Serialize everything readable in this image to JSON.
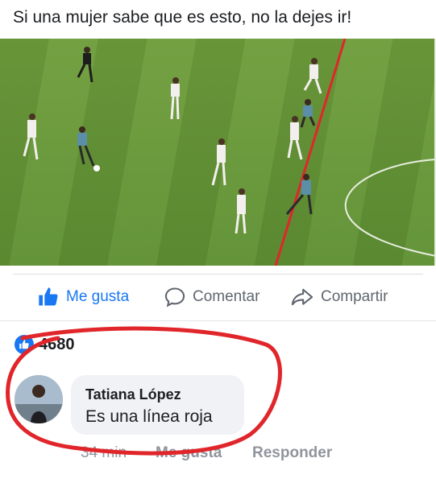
{
  "post": {
    "caption": "Si una mujer sabe que es esto, no la dejes ir!"
  },
  "actions": {
    "like_label": "Me gusta",
    "comment_label": "Comentar",
    "share_label": "Compartir"
  },
  "reactions": {
    "count": "4680"
  },
  "comment": {
    "author": "Tatiana López",
    "text": "Es una línea roja",
    "time": "34 min",
    "like_label": "Me gusta",
    "reply_label": "Responder"
  },
  "colors": {
    "accent": "#1877f2",
    "annotation": "#e0262a",
    "pitch": "#66993a"
  },
  "icons": {
    "like": "thumbs-up-icon",
    "comment": "speech-bubble-icon",
    "share": "share-arrow-icon"
  }
}
